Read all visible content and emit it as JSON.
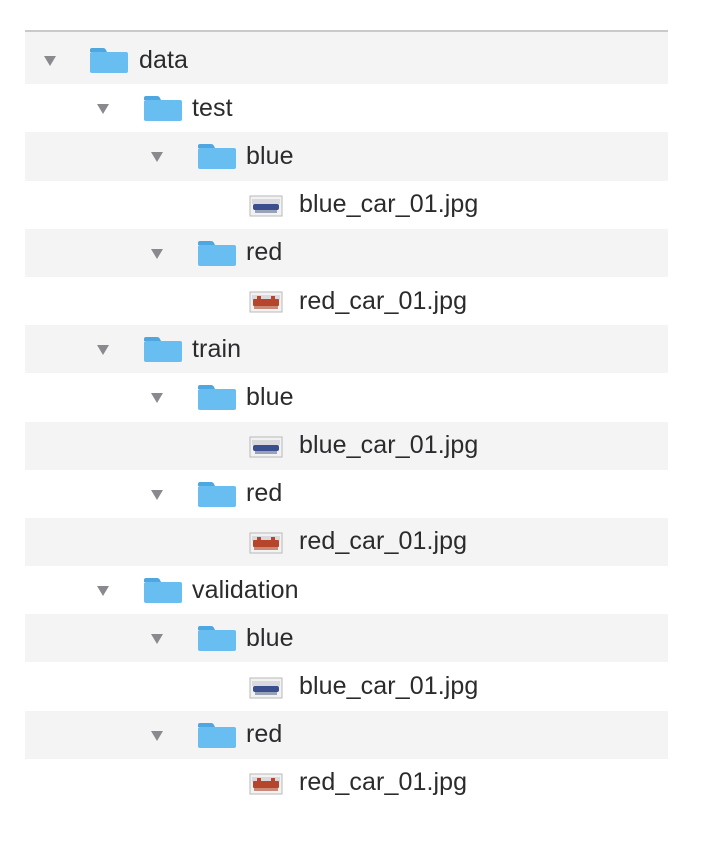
{
  "colors": {
    "folder": "#68bdf1",
    "folder_tab": "#4fa7e2",
    "disclosure": "#8a8a8e",
    "text": "#2b2b2e",
    "row_alt": "#ffffff",
    "row_base": "#f4f4f5",
    "blue_thumb": "#3b4f8e",
    "red_thumb": "#b5462b"
  },
  "tree": [
    {
      "label": "data",
      "kind": "folder",
      "level": 0,
      "expanded": true,
      "icon": "folder-icon"
    },
    {
      "label": "test",
      "kind": "folder",
      "level": 1,
      "expanded": true,
      "icon": "folder-icon"
    },
    {
      "label": "blue",
      "kind": "folder",
      "level": 2,
      "expanded": true,
      "icon": "folder-icon"
    },
    {
      "label": "blue_car_01.jpg",
      "kind": "file",
      "level": 3,
      "icon": "blue-image-thumbnail-icon"
    },
    {
      "label": "red",
      "kind": "folder",
      "level": 2,
      "expanded": true,
      "icon": "folder-icon"
    },
    {
      "label": "red_car_01.jpg",
      "kind": "file",
      "level": 3,
      "icon": "red-image-thumbnail-icon"
    },
    {
      "label": "train",
      "kind": "folder",
      "level": 1,
      "expanded": true,
      "icon": "folder-icon"
    },
    {
      "label": "blue",
      "kind": "folder",
      "level": 2,
      "expanded": true,
      "icon": "folder-icon"
    },
    {
      "label": "blue_car_01.jpg",
      "kind": "file",
      "level": 3,
      "icon": "blue-image-thumbnail-icon"
    },
    {
      "label": "red",
      "kind": "folder",
      "level": 2,
      "expanded": true,
      "icon": "folder-icon"
    },
    {
      "label": "red_car_01.jpg",
      "kind": "file",
      "level": 3,
      "icon": "red-image-thumbnail-icon"
    },
    {
      "label": "validation",
      "kind": "folder",
      "level": 1,
      "expanded": true,
      "icon": "folder-icon"
    },
    {
      "label": "blue",
      "kind": "folder",
      "level": 2,
      "expanded": true,
      "icon": "folder-icon"
    },
    {
      "label": "blue_car_01.jpg",
      "kind": "file",
      "level": 3,
      "icon": "blue-image-thumbnail-icon"
    },
    {
      "label": "red",
      "kind": "folder",
      "level": 2,
      "expanded": true,
      "icon": "folder-icon"
    },
    {
      "label": "red_car_01.jpg",
      "kind": "file",
      "level": 3,
      "icon": "red-image-thumbnail-icon"
    }
  ]
}
